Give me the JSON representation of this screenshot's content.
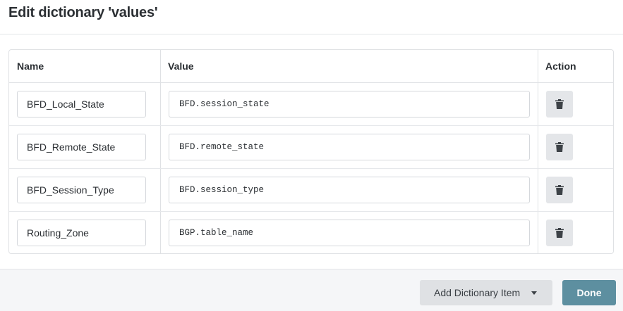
{
  "dialog": {
    "title": "Edit dictionary 'values'"
  },
  "table": {
    "headers": {
      "name": "Name",
      "value": "Value",
      "action": "Action"
    },
    "rows": [
      {
        "name": "BFD_Local_State",
        "value": "BFD.session_state"
      },
      {
        "name": "BFD_Remote_State",
        "value": "BFD.remote_state"
      },
      {
        "name": "BFD_Session_Type",
        "value": "BFD.session_type"
      },
      {
        "name": "Routing_Zone",
        "value": "BGP.table_name"
      }
    ],
    "delete_icon": "trash-icon"
  },
  "footer": {
    "add_label": "Add Dictionary Item",
    "add_icon": "caret-down-icon",
    "done_label": "Done"
  },
  "colors": {
    "done_button": "#5d8fa0",
    "delete_button": "#e4e6e9",
    "add_button": "#dfe1e4"
  }
}
